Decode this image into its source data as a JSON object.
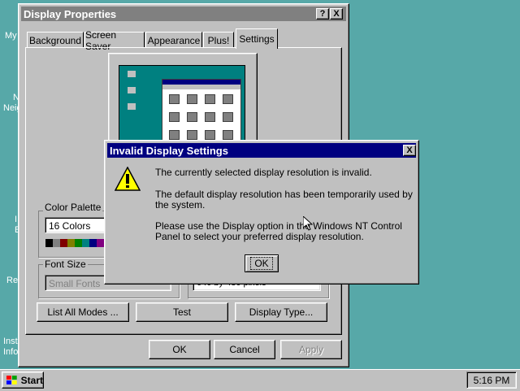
{
  "desktop": {
    "icon_labels": [
      "My",
      "N",
      "Neig",
      "I",
      "E",
      "Re",
      "Inst",
      "Info"
    ]
  },
  "display_properties": {
    "title": "Display Properties",
    "help_button": "?",
    "close_button": "X",
    "tabs": [
      "Background",
      "Screen Saver",
      "Appearance",
      "Plus!",
      "Settings"
    ],
    "active_tab": "Settings",
    "color_palette": {
      "label": "Color Palette",
      "value": "16 Colors",
      "swatches": [
        "#000000",
        "#808080",
        "#800000",
        "#808000",
        "#008000",
        "#008080",
        "#000080",
        "#800080",
        "#c0c0c0"
      ]
    },
    "font_size": {
      "label": "Font Size",
      "value": "Small Fonts"
    },
    "desktop_area_value": "640 by 480 pixels",
    "buttons": {
      "list_all_modes": "List All Modes ...",
      "test": "Test",
      "display_type": "Display Type...",
      "ok": "OK",
      "cancel": "Cancel",
      "apply": "Apply"
    }
  },
  "dialog": {
    "title": "Invalid Display Settings",
    "close_button": "X",
    "icon": "warning-icon",
    "message_1": "The currently selected display resolution is invalid.",
    "message_2": "The default display resolution has been temporarily used by the system.",
    "message_3": "Please use the Display option in the Windows NT Control Panel to select your preferred display resolution.",
    "ok": "OK"
  },
  "taskbar": {
    "start_label": "Start",
    "clock": "5:16 PM"
  },
  "colors": {
    "desktop": "#57a8a8",
    "active_title": "#000080",
    "inactive_title": "#808080",
    "face": "#c0c0c0"
  }
}
